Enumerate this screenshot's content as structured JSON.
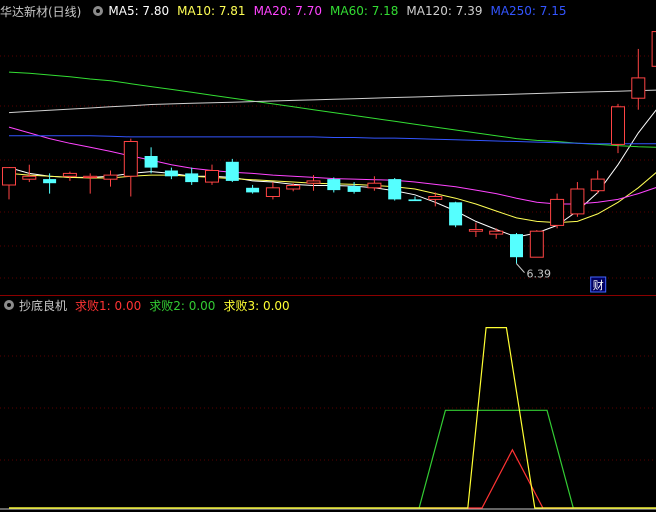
{
  "main_header": {
    "title": "华达新材(日线)",
    "ma_items": [
      {
        "label": "MA5: 7.80",
        "color": "#ffffff"
      },
      {
        "label": "MA10: 7.81",
        "color": "#ffff55"
      },
      {
        "label": "MA20: 7.70",
        "color": "#ff44ff"
      },
      {
        "label": "MA60: 7.18",
        "color": "#33dd33"
      },
      {
        "label": "MA120: 7.39",
        "color": "#cfcfcf"
      },
      {
        "label": "MA250: 7.15",
        "color": "#3355ff"
      }
    ]
  },
  "indicator_header": {
    "title": "抄底良机",
    "items": [
      {
        "label": "求败1: 0.00",
        "color": "#ff3333"
      },
      {
        "label": "求败2: 0.00",
        "color": "#33cc33"
      },
      {
        "label": "求败3: 0.00",
        "color": "#ffff33"
      }
    ]
  },
  "chart_data": [
    {
      "type": "candlestick",
      "title": "华达新材(日线)",
      "ylim": [
        5.9,
        10.6
      ],
      "up_color": "#ff4444",
      "down_color": "#55ffff",
      "candles": [
        {
          "o": 7.75,
          "h": 8.05,
          "l": 7.5,
          "c": 8.05
        },
        {
          "o": 7.85,
          "h": 8.1,
          "l": 7.8,
          "c": 7.9
        },
        {
          "o": 7.85,
          "h": 7.95,
          "l": 7.6,
          "c": 7.78
        },
        {
          "o": 7.9,
          "h": 7.98,
          "l": 7.82,
          "c": 7.95
        },
        {
          "o": 7.88,
          "h": 7.95,
          "l": 7.6,
          "c": 7.9
        },
        {
          "o": 7.85,
          "h": 8.0,
          "l": 7.72,
          "c": 7.92
        },
        {
          "o": 7.9,
          "h": 8.55,
          "l": 7.55,
          "c": 8.5
        },
        {
          "o": 8.25,
          "h": 8.4,
          "l": 7.95,
          "c": 8.05
        },
        {
          "o": 8.0,
          "h": 8.05,
          "l": 7.85,
          "c": 7.9
        },
        {
          "o": 7.95,
          "h": 8.05,
          "l": 7.75,
          "c": 7.8
        },
        {
          "o": 7.8,
          "h": 8.1,
          "l": 7.75,
          "c": 8.0
        },
        {
          "o": 8.15,
          "h": 8.2,
          "l": 7.8,
          "c": 7.82
        },
        {
          "o": 7.7,
          "h": 7.75,
          "l": 7.6,
          "c": 7.62
        },
        {
          "o": 7.55,
          "h": 7.8,
          "l": 7.5,
          "c": 7.7
        },
        {
          "o": 7.68,
          "h": 7.78,
          "l": 7.64,
          "c": 7.74
        },
        {
          "o": 7.78,
          "h": 7.92,
          "l": 7.65,
          "c": 7.82
        },
        {
          "o": 7.85,
          "h": 7.88,
          "l": 7.62,
          "c": 7.66
        },
        {
          "o": 7.73,
          "h": 7.8,
          "l": 7.6,
          "c": 7.63
        },
        {
          "o": 7.7,
          "h": 7.9,
          "l": 7.65,
          "c": 7.78
        },
        {
          "o": 7.85,
          "h": 7.87,
          "l": 7.48,
          "c": 7.5
        },
        {
          "o": 7.5,
          "h": 7.55,
          "l": 7.48,
          "c": 7.47
        },
        {
          "o": 7.5,
          "h": 7.62,
          "l": 7.38,
          "c": 7.55
        },
        {
          "o": 7.45,
          "h": 7.46,
          "l": 7.02,
          "c": 7.05
        },
        {
          "o": 6.95,
          "h": 7.1,
          "l": 6.85,
          "c": 6.98
        },
        {
          "o": 6.9,
          "h": 7.0,
          "l": 6.82,
          "c": 6.95
        },
        {
          "o": 6.9,
          "h": 6.92,
          "l": 6.39,
          "c": 6.5
        },
        {
          "o": 6.5,
          "h": 6.97,
          "l": 6.5,
          "c": 6.95
        },
        {
          "o": 7.05,
          "h": 7.6,
          "l": 7.0,
          "c": 7.5
        },
        {
          "o": 7.25,
          "h": 7.8,
          "l": 7.2,
          "c": 7.68
        },
        {
          "o": 7.65,
          "h": 8.0,
          "l": 7.6,
          "c": 7.85
        },
        {
          "o": 8.45,
          "h": 9.15,
          "l": 8.3,
          "c": 9.1
        },
        {
          "o": 9.25,
          "h": 10.1,
          "l": 9.05,
          "c": 9.6
        },
        {
          "o": 9.8,
          "h": 10.48,
          "l": 9.7,
          "c": 10.4
        },
        {
          "o": 9.95,
          "h": 10.02,
          "l": 9.85,
          "c": 9.85
        }
      ],
      "ma_series": [
        {
          "name": "MA5",
          "color": "#ffffff",
          "values": [
            8.05,
            7.95,
            7.9,
            7.88,
            7.88,
            7.9,
            7.95,
            7.98,
            7.95,
            7.9,
            7.9,
            7.88,
            7.82,
            7.8,
            7.76,
            7.74,
            7.74,
            7.73,
            7.7,
            7.65,
            7.58,
            7.45,
            7.3,
            7.12,
            6.98,
            6.85,
            6.92,
            7.05,
            7.3,
            7.62,
            8.1,
            8.65,
            9.1,
            9.45
          ]
        },
        {
          "name": "MA10",
          "color": "#ffff55",
          "values": [
            7.95,
            7.92,
            7.9,
            7.88,
            7.87,
            7.87,
            7.9,
            7.92,
            7.92,
            7.9,
            7.88,
            7.86,
            7.84,
            7.82,
            7.8,
            7.78,
            7.77,
            7.76,
            7.74,
            7.72,
            7.68,
            7.6,
            7.52,
            7.42,
            7.3,
            7.18,
            7.12,
            7.1,
            7.12,
            7.25,
            7.45,
            7.7,
            8.0,
            8.3
          ]
        },
        {
          "name": "MA20",
          "color": "#ff44ff",
          "values": [
            8.75,
            8.65,
            8.55,
            8.47,
            8.4,
            8.33,
            8.25,
            8.18,
            8.1,
            8.04,
            8.0,
            7.97,
            7.95,
            7.92,
            7.9,
            7.88,
            7.86,
            7.85,
            7.84,
            7.83,
            7.8,
            7.76,
            7.72,
            7.66,
            7.6,
            7.52,
            7.45,
            7.42,
            7.42,
            7.45,
            7.5,
            7.6,
            7.72,
            7.85
          ]
        },
        {
          "name": "MA60",
          "color": "#33dd33",
          "values": [
            9.7,
            9.68,
            9.65,
            9.62,
            9.58,
            9.55,
            9.5,
            9.45,
            9.4,
            9.35,
            9.3,
            9.25,
            9.2,
            9.15,
            9.1,
            9.05,
            9.0,
            8.95,
            8.9,
            8.85,
            8.8,
            8.75,
            8.7,
            8.65,
            8.6,
            8.55,
            8.52,
            8.5,
            8.47,
            8.45,
            8.43,
            8.41,
            8.4,
            8.39
          ]
        },
        {
          "name": "MA120",
          "color": "#cfcfcf",
          "values": [
            9.0,
            9.02,
            9.04,
            9.06,
            9.08,
            9.1,
            9.12,
            9.14,
            9.15,
            9.16,
            9.17,
            9.18,
            9.19,
            9.2,
            9.21,
            9.22,
            9.23,
            9.24,
            9.25,
            9.26,
            9.27,
            9.28,
            9.29,
            9.3,
            9.31,
            9.32,
            9.33,
            9.34,
            9.35,
            9.36,
            9.37,
            9.38,
            9.39,
            9.4
          ]
        },
        {
          "name": "MA250",
          "color": "#3355ff",
          "values": [
            8.6,
            8.6,
            8.6,
            8.6,
            8.6,
            8.59,
            8.58,
            8.58,
            8.58,
            8.58,
            8.58,
            8.58,
            8.58,
            8.58,
            8.58,
            8.58,
            8.57,
            8.57,
            8.56,
            8.56,
            8.55,
            8.54,
            8.53,
            8.52,
            8.51,
            8.5,
            8.49,
            8.48,
            8.47,
            8.46,
            8.46,
            8.46,
            8.46,
            8.46
          ]
        }
      ],
      "annotations": {
        "low_label": "6.39",
        "low_index": 25,
        "marker_label": "财",
        "marker_index": 29
      }
    },
    {
      "type": "line",
      "title": "抄底良机",
      "ylim": [
        0,
        3.3
      ],
      "x_count": 34,
      "series": [
        {
          "name": "求败1",
          "color": "#ff3333",
          "points": [
            [
              0,
              0
            ],
            [
              23.3,
              0
            ],
            [
              24.8,
              1
            ],
            [
              26.3,
              0
            ],
            [
              33,
              0
            ]
          ]
        },
        {
          "name": "求败2",
          "color": "#33cc33",
          "points": [
            [
              0,
              0
            ],
            [
              20.2,
              0
            ],
            [
              21.5,
              1.68
            ],
            [
              26.5,
              1.68
            ],
            [
              27.8,
              0
            ],
            [
              33,
              0
            ]
          ]
        },
        {
          "name": "求败3",
          "color": "#ffff33",
          "points": [
            [
              0,
              0
            ],
            [
              22.6,
              0
            ],
            [
              23.5,
              3.1
            ],
            [
              24.5,
              3.1
            ],
            [
              25.9,
              0
            ],
            [
              33,
              0
            ]
          ]
        }
      ]
    }
  ]
}
